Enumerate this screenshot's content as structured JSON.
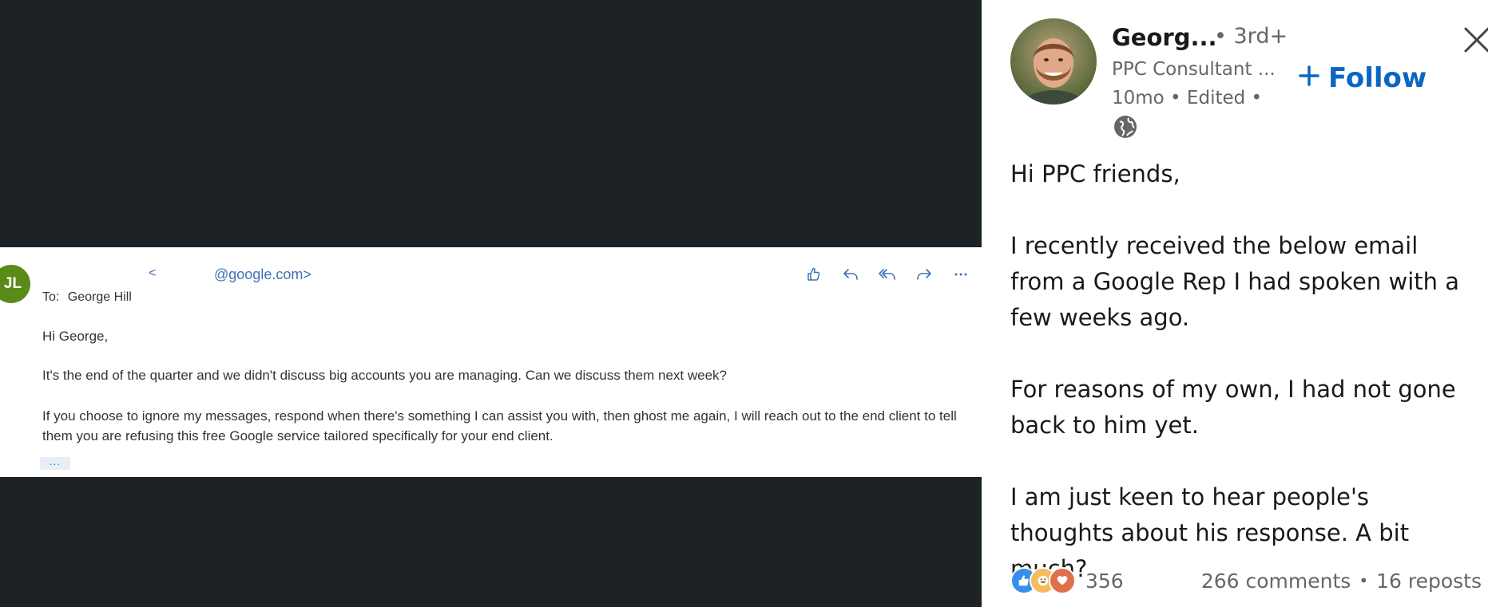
{
  "email": {
    "avatar_initials": "JL",
    "sender_prefix": "<",
    "sender_domain": "@google.com>",
    "to_label": "To:",
    "to_name": "George Hill",
    "greeting": "Hi George,",
    "paragraph1": "It's the end of the quarter and we didn't discuss big accounts you are managing.  Can we discuss them next week?",
    "paragraph2": "If you choose to ignore my messages, respond when there's something I can assist you with, then ghost me again, I will reach out to the end client to tell them you are refusing this free Google service tailored specifically for your end client.",
    "more_label": "...",
    "actions": [
      "like-icon",
      "reply-icon",
      "reply-all-icon",
      "forward-icon",
      "more-icon"
    ]
  },
  "author": {
    "name": "Georg...",
    "degree": "• 3rd+",
    "headline": "PPC Consultant ...",
    "meta": "10mo • Edited •"
  },
  "follow_label": "Follow",
  "post": {
    "p1": "Hi PPC friends,",
    "p2": "I recently received the below email from a Google Rep I had spoken with a few weeks ago.",
    "p3": "For reasons of my own, I had not gone back to him yet.",
    "p4": "I am just keen to hear people's thoughts about his response. A bit much?"
  },
  "social": {
    "reaction_count": "356",
    "comments": "266 comments",
    "separator": "•",
    "reposts": "16 reposts"
  },
  "colors": {
    "accent": "#0a66c2",
    "media_bg": "#1d2226",
    "email_link": "#3d72b4",
    "avatar_green": "#5a8a17"
  }
}
